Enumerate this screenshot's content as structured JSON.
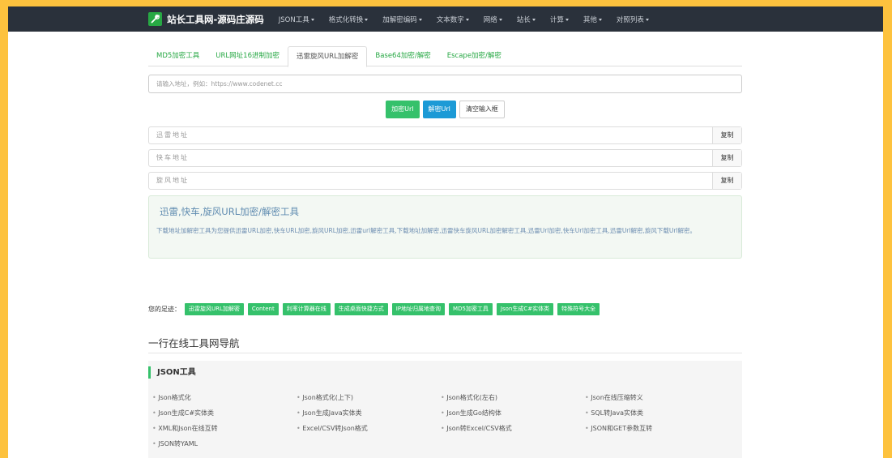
{
  "navbar": {
    "brand": "站长工具网-源码庄源码",
    "items": [
      "JSON工具",
      "格式化转换",
      "加解密编码",
      "文本数字",
      "网络",
      "站长",
      "计算",
      "其他",
      "对照列表"
    ]
  },
  "tabs": [
    "MD5加密工具",
    "URL网址16进制加密",
    "迅雷旋风URL加解密",
    "Base64加密/解密",
    "Escape加密/解密"
  ],
  "url_input": {
    "placeholder": "请输入地址，例如：https://www.codenet.cc"
  },
  "buttons": {
    "encrypt": "加密Url",
    "decrypt": "解密Url",
    "clear": "清空输入框"
  },
  "addresses": [
    {
      "placeholder": "迅雷地址",
      "copy": "复制"
    },
    {
      "placeholder": "快车地址",
      "copy": "复制"
    },
    {
      "placeholder": "旋风地址",
      "copy": "复制"
    }
  ],
  "info": {
    "title": "迅雷,快车,旋风URL加密/解密工具",
    "text": "下载地址加解密工具为您提供迅雷URL加密,快车URL加密,旋风URL加密,迅雷url解密工具,下载地址加解密,迅雷快车旋风URL加密解密工具,迅雷Url加密,快车Url加密工具,迅雷Url解密,旋风下载Url解密。"
  },
  "footprint": {
    "label": "您的足迹：",
    "tags": [
      "迅雷旋风URL加解密",
      "Content",
      "利率计算器在线",
      "生成桌面快捷方式",
      "IP地址归属地查询",
      "MD5加密工具",
      "Json生成C#实体类",
      "特殊符号大全"
    ]
  },
  "section_title": "一行在线工具网导航",
  "json_tools": {
    "heading": "JSON工具",
    "links": [
      "Json格式化",
      "Json格式化(上下)",
      "Json格式化(左右)",
      "Json在线压缩转义",
      "Json生成C#实体类",
      "Json生成Java实体类",
      "Json生成Go结构体",
      "SQL转Java实体类",
      "XML和Json在线互转",
      "Excel/CSV转Json格式",
      "Json转Excel/CSV格式",
      "JSON和GET参数互转",
      "JSON转YAML"
    ]
  },
  "colors": {
    "accent_green": "#35c16b",
    "accent_blue": "#1c9ad6",
    "navbar_bg": "#2a313b",
    "page_border": "#fdc23e"
  }
}
